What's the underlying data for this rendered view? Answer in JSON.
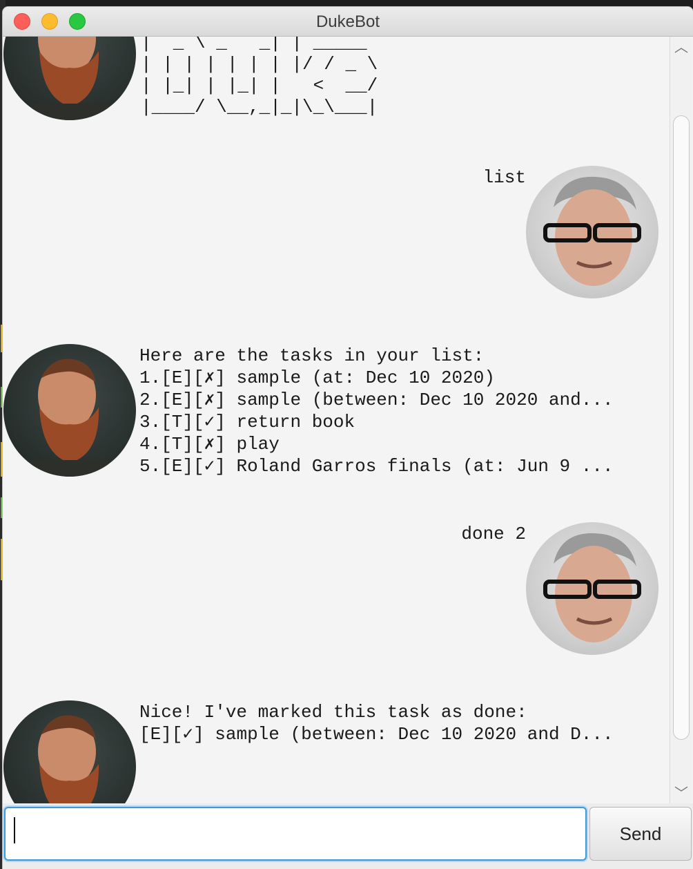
{
  "window": {
    "title": "DukeBot"
  },
  "chat": {
    "messages": [
      {
        "sender": "duke",
        "avatar_icon": "duke-avatar-icon",
        "ascii_logo": "|  _ \\ _   _| | _____\n| | | | | | | |/ / _ \\\n| |_| | |_| |   <  __/\n|____/ \\__,_|_|\\_\\___|"
      },
      {
        "sender": "user",
        "avatar_icon": "user-avatar-icon",
        "text": "list"
      },
      {
        "sender": "duke",
        "avatar_icon": "duke-avatar-icon",
        "text": "Here are the tasks in your list:\n1.[E][✗] sample (at: Dec 10 2020)\n2.[E][✗] sample (between: Dec 10 2020 and...\n3.[T][✓] return book\n4.[T][✗] play\n5.[E][✓] Roland Garros finals (at: Jun 9 ..."
      },
      {
        "sender": "user",
        "avatar_icon": "user-avatar-icon",
        "text": "done 2"
      },
      {
        "sender": "duke",
        "avatar_icon": "duke-avatar-icon",
        "text": "Nice! I've marked this task as done:\n[E][✓] sample (between: Dec 10 2020 and D..."
      }
    ]
  },
  "input": {
    "value": "",
    "placeholder": ""
  },
  "send_button": {
    "label": "Send"
  },
  "colors": {
    "close": "#fc5f57",
    "minimize": "#fdbc2e",
    "maximize": "#29c840",
    "focus_ring": "#3d9ad9",
    "background": "#f4f4f4"
  }
}
